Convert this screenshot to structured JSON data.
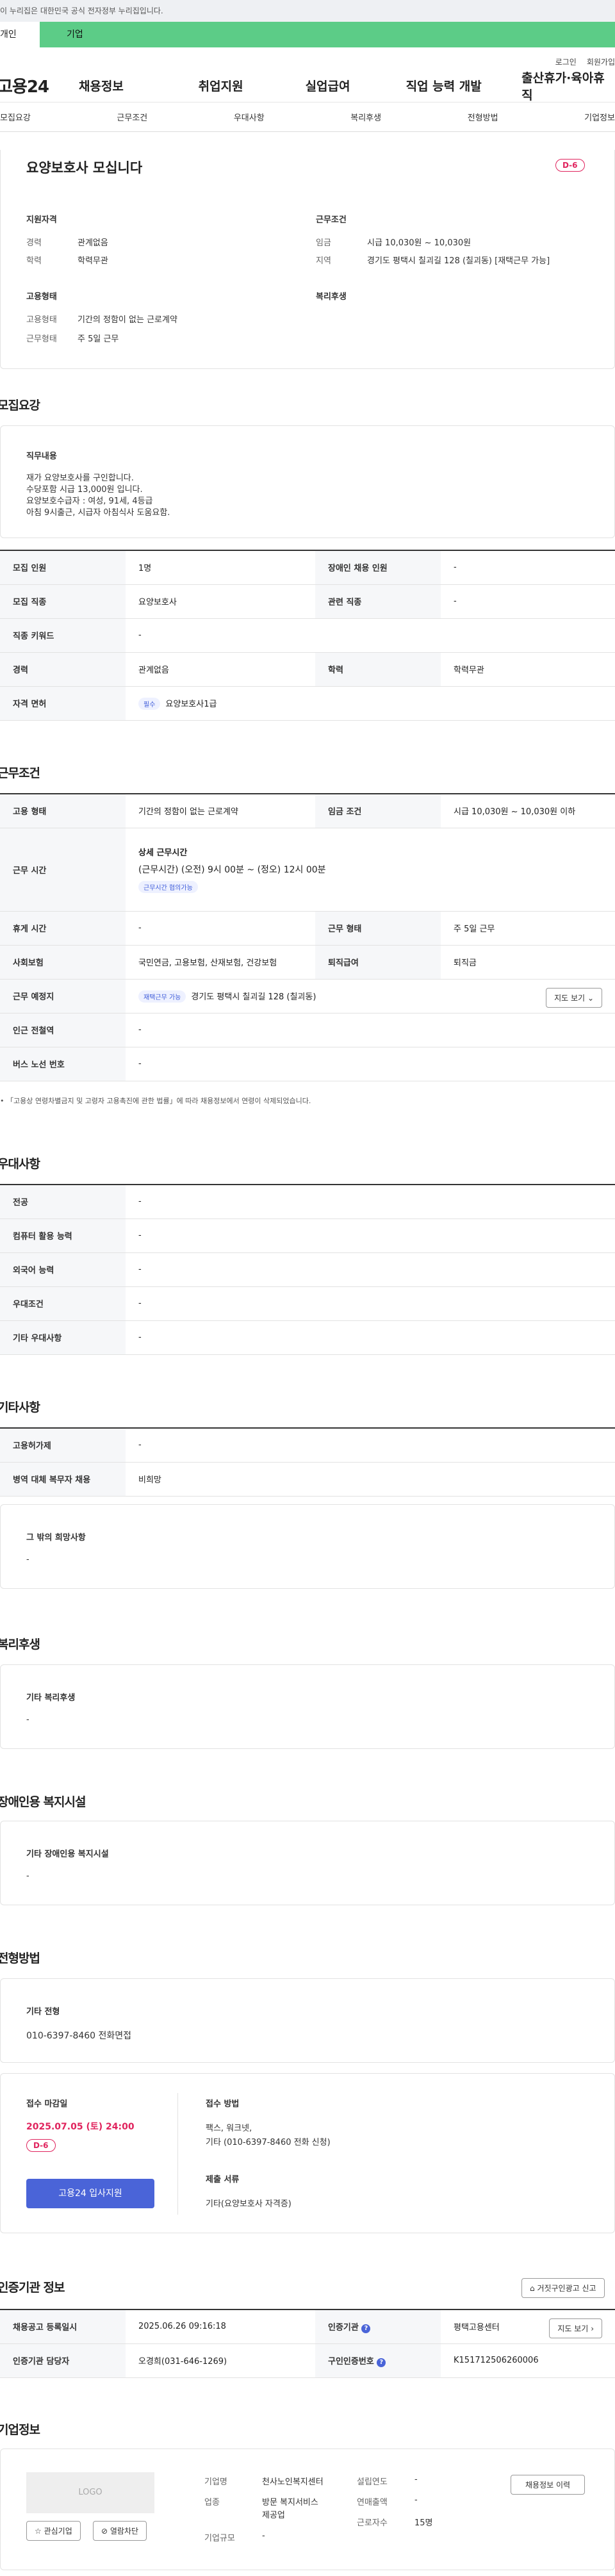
{
  "gov_banner": "이 누리집은 대한민국 공식 전자정부 누리집입니다.",
  "user_tabs": {
    "personal": "개인",
    "company": "기업"
  },
  "util": {
    "login": "로그인",
    "join": "회원가입"
  },
  "logo": "고용24",
  "gnb": [
    "채용정보",
    "취업지원",
    "실업급여",
    "직업 능력 개발",
    "출산휴가·육아휴직"
  ],
  "subnav": [
    "모집요강",
    "근무조건",
    "우대사항",
    "복리후생",
    "전형방법",
    "기업정보"
  ],
  "summary": {
    "title": "요양보호사 모십니다",
    "dday": "D-6",
    "qual_title": "지원자격",
    "qual": [
      {
        "k": "경력",
        "v": "관계없음"
      },
      {
        "k": "학력",
        "v": "학력무관"
      }
    ],
    "cond_title": "근무조건",
    "cond": [
      {
        "k": "임금",
        "v": "시급 10,030원 ~ 10,030원"
      },
      {
        "k": "지역",
        "v": "경기도 평택시 칠괴길 128 (칠괴동) [재택근무 가능]"
      }
    ],
    "emp_title": "고용형태",
    "emp": [
      {
        "k": "고용형태",
        "v": "기간의 정함이 없는 근로계약"
      },
      {
        "k": "근무형태",
        "v": "주 5일 근무"
      }
    ],
    "welfare_title": "복리후생"
  },
  "recruit": {
    "heading": "모집요강",
    "duty_title": "직무내용",
    "duty_lines": [
      "재가 요양보호사를 구인합니다.",
      "수당포함 시급 13,000원 입니다.",
      "요양보호수급자 : 여성, 91세, 4등급",
      "아침 9시출근, 시급자 아침식사 도움요함."
    ],
    "rows": [
      {
        "k1": "모집 인원",
        "v1": "1명",
        "k2": "장애인 채용 인원",
        "v2": "-"
      },
      {
        "k1": "모집 직종",
        "v1": "요양보호사",
        "k2": "관련 직종",
        "v2": "-"
      },
      {
        "k1": "직종 키워드",
        "v1": "-"
      },
      {
        "k1": "경력",
        "v1": "관계없음",
        "k2": "학력",
        "v2": "학력무관"
      }
    ],
    "license_label": "자격 면허",
    "license_pill": "필수",
    "license_value": "요양보호사1급"
  },
  "work": {
    "heading": "근무조건",
    "emp_label": "고용 형태",
    "emp_value": "기간의 정함이 없는 근로계약",
    "wage_label": "임금 조건",
    "wage_value": "시급 10,030원 ~ 10,030원 이하",
    "time_label": "근무 시간",
    "time_title": "상세 근무시간",
    "time_value": "(근무시간) (오전) 9시 00분 ~ (정오) 12시 00분",
    "time_pill": "근무시간 협의가능",
    "rest_label": "휴게 시간",
    "rest_value": "-",
    "form_label": "근무 형태",
    "form_value": "주 5일 근무",
    "ins_label": "사회보험",
    "ins_value": "국민연금, 고용보험, 산재보험, 건강보험",
    "sev_label": "퇴직급여",
    "sev_value": "퇴직금",
    "place_label": "근무 예정지",
    "place_pill": "재택근무 가능",
    "place_value": "경기도 평택시 칠괴길 128 (칠괴동)",
    "map_btn": "지도 보기",
    "subway_label": "인근 전철역",
    "subway_value": "-",
    "bus_label": "버스 노선 번호",
    "bus_value": "-",
    "note": "「고용상 연령차별금지 및 고령자 고용촉진에 관한 법률」에 따라 채용정보에서 연령이 삭제되었습니다."
  },
  "pref": {
    "heading": "우대사항",
    "rows": [
      {
        "k": "전공",
        "v": "-"
      },
      {
        "k": "컴퓨터 활용 능력",
        "v": "-"
      },
      {
        "k": "외국어 능력",
        "v": "-"
      },
      {
        "k": "우대조건",
        "v": "-"
      },
      {
        "k": "기타 우대사항",
        "v": "-"
      }
    ]
  },
  "etc": {
    "heading": "기타사항",
    "rows": [
      {
        "k": "고용허가제",
        "v": "-"
      },
      {
        "k": "병역 대체 복무자 채용",
        "v": "비희망"
      }
    ],
    "other_title": "그 밖의 희망사항",
    "other_value": "-"
  },
  "welfare": {
    "heading": "복리후생",
    "title": "기타 복리후생",
    "value": "-"
  },
  "disabled": {
    "heading": "장애인용 복지시설",
    "title": "기타 장애인용 복지시설",
    "value": "-"
  },
  "process": {
    "heading": "전형방법",
    "etc_title": "기타 전형",
    "etc_value": "010-6397-8460 전화면접",
    "deadline_title": "접수 마감일",
    "deadline_value": "2025.07.05 (토) 24:00",
    "dday": "D-6",
    "apply_btn": "고용24 입사지원",
    "method_title": "접수 방법",
    "method_lines": [
      "팩스, 워크넷,",
      "기타 (010-6397-8460 전화 신청)"
    ],
    "docs_title": "제출 서류",
    "docs_value": "기타(요양보호사 자격증)"
  },
  "agency": {
    "heading": "인증기관 정보",
    "report_btn": "거짓구인광고 신고",
    "r1k1": "채용공고 등록일시",
    "r1v1": "2025.06.26 09:16:18",
    "r1k2": "인증기관",
    "r1v2": "평택고용센터",
    "map_btn": "지도 보기",
    "r2k1": "인증기관 담당자",
    "r2v1": "오경희(031-646-1269)",
    "r2k2": "구인인증번호",
    "r2v2": "K151712506260006"
  },
  "company": {
    "heading": "기업정보",
    "logo": "LOGO",
    "fav_btn": "관심기업",
    "block_btn": "열람차단",
    "history_btn": "채용정보 이력",
    "name_k": "기업명",
    "name_v": "천사노인복지센터",
    "year_k": "설립연도",
    "year_v": "-",
    "ind_k": "업종",
    "ind_v1": "방문 복지서비스",
    "ind_v2": "제공업",
    "sales_k": "연매출액",
    "sales_v": "-",
    "emp_k": "근로자수",
    "emp_v": "15명",
    "size_k": "기업규모",
    "size_v": "-"
  }
}
